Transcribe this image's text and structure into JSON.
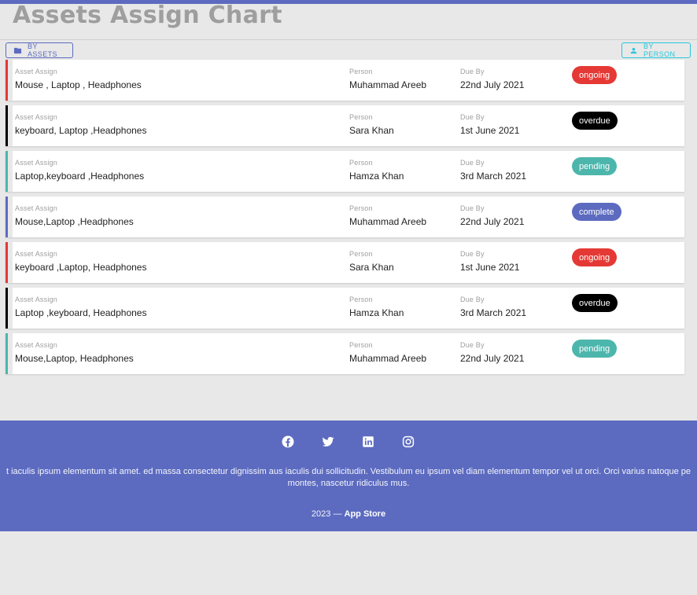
{
  "page": {
    "title": "Assets Assign Chart"
  },
  "tabs": {
    "by_assets": "BY ASSETS",
    "by_person": "BY PERSON"
  },
  "labels": {
    "asset": "Asset Assign",
    "person": "Person",
    "due": "Due By"
  },
  "status_colors": {
    "ongoing": "#e53935",
    "overdue": "#000000",
    "pending": "#4db6ac",
    "complete": "#5c6bc0"
  },
  "rows": [
    {
      "assets": "Mouse , Laptop , Headphones",
      "person": "Muhammad Areeb",
      "due": "22nd July 2021",
      "status": "ongoing"
    },
    {
      "assets": "keyboard, Laptop ,Headphones",
      "person": "Sara Khan",
      "due": "1st June 2021",
      "status": "overdue"
    },
    {
      "assets": "Laptop,keyboard ,Headphones",
      "person": "Hamza Khan",
      "due": "3rd March 2021",
      "status": "pending"
    },
    {
      "assets": "Mouse,Laptop ,Headphones",
      "person": "Muhammad Areeb",
      "due": "22nd July 2021",
      "status": "complete"
    },
    {
      "assets": "keyboard ,Laptop, Headphones",
      "person": "Sara Khan",
      "due": "1st June 2021",
      "status": "ongoing"
    },
    {
      "assets": "Laptop ,keyboard, Headphones",
      "person": "Hamza Khan",
      "due": "3rd March 2021",
      "status": "overdue"
    },
    {
      "assets": "Mouse,Laptop, Headphones",
      "person": "Muhammad Areeb",
      "due": "22nd July 2021",
      "status": "pending"
    }
  ],
  "footer": {
    "social": [
      "facebook-icon",
      "twitter-icon",
      "linkedin-icon",
      "instagram-icon"
    ],
    "text": "t iaculis ipsum elementum sit amet. ed massa consectetur dignissim aus iaculis dui sollicitudin. Vestibulum eu ipsum vel diam elementum tempor vel ut orci. Orci varius natoque pe montes, nascetur ridiculus mus.",
    "year": "2023",
    "separator": "—",
    "brand": "App Store"
  }
}
